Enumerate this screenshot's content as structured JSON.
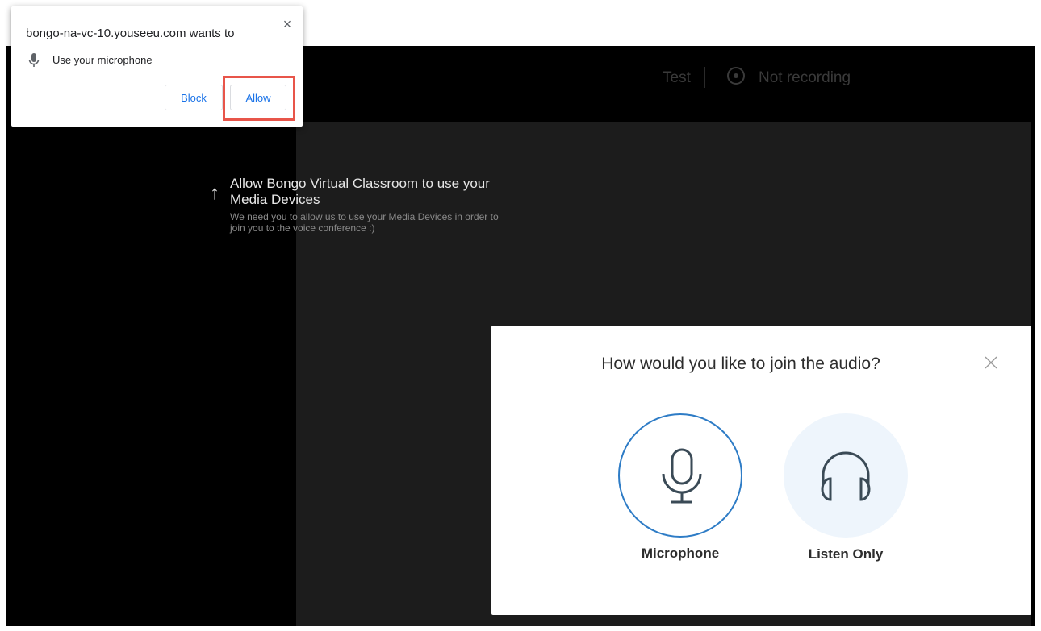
{
  "header": {
    "test_label": "Test",
    "recording_label": "Not recording"
  },
  "media_hint": {
    "title": "Allow Bongo Virtual Classroom to use your Media Devices",
    "body": "We need you to allow us to use your Media Devices in order to join you to the voice conference :)"
  },
  "permission_popup": {
    "origin_text": "bongo-na-vc-10.youseeu.com wants to",
    "close_glyph": "×",
    "permission_text": "Use your microphone",
    "block_label": "Block",
    "allow_label": "Allow",
    "highlight_color": "#e8554a"
  },
  "audio_modal": {
    "title": "How would you like to join the audio?",
    "options": [
      {
        "label": "Microphone",
        "icon": "microphone-icon",
        "selected": true
      },
      {
        "label": "Listen Only",
        "icon": "headphones-icon",
        "selected": false
      }
    ]
  },
  "colors": {
    "accent_blue": "#2e7cc6",
    "link_blue": "#1a73e8",
    "background": "#000000",
    "content_bg": "#1c1c1c"
  }
}
